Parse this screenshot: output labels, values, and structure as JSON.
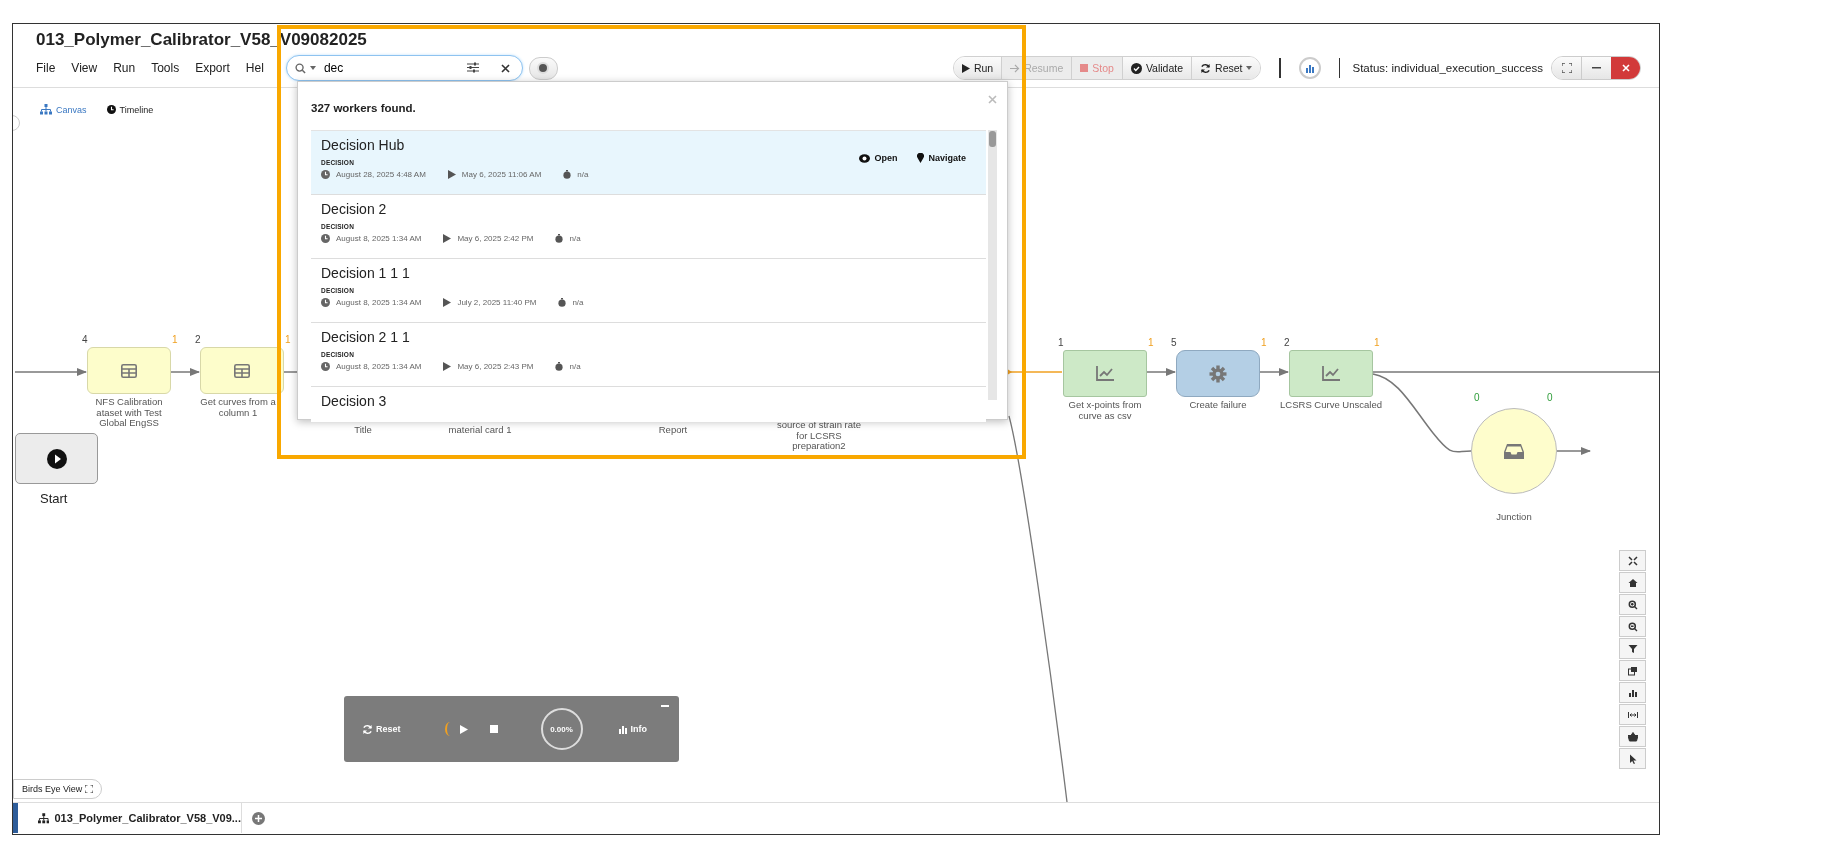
{
  "window": {
    "title": "013_Polymer_Calibrator_V58_V09082025"
  },
  "menu": [
    "File",
    "View",
    "Run",
    "Tools",
    "Export",
    "Hel"
  ],
  "search": {
    "value": "dec"
  },
  "toolbar": {
    "buttons": [
      {
        "label": "Run",
        "kind": "run",
        "disabled": false
      },
      {
        "label": "Resume",
        "kind": "resume",
        "disabled": true
      },
      {
        "label": "Stop",
        "kind": "stop",
        "disabled": true
      },
      {
        "label": "Validate",
        "kind": "validate",
        "disabled": false
      },
      {
        "label": "Reset",
        "kind": "reset",
        "disabled": false
      }
    ],
    "status": "Status: individual_execution_success"
  },
  "view_tabs": [
    {
      "label": "Canvas",
      "kind": "canvas",
      "selected": true
    },
    {
      "label": "Timeline",
      "kind": "timeline",
      "selected": false
    }
  ],
  "search_results": {
    "summary": "327 workers found.",
    "items": [
      {
        "title": "Decision Hub",
        "type": "DECISION",
        "modified": "August 28, 2025 4:48 AM",
        "last_run": "May 6, 2025 11:06 AM",
        "duration": "n/a",
        "selected": true,
        "actions": [
          "Open",
          "Navigate"
        ]
      },
      {
        "title": "Decision 2",
        "type": "DECISION",
        "modified": "August 8, 2025 1:34 AM",
        "last_run": "May 6, 2025 2:42 PM",
        "duration": "n/a",
        "selected": false
      },
      {
        "title": "Decision 1 1 1",
        "type": "DECISION",
        "modified": "August 8, 2025 1:34 AM",
        "last_run": "July 2, 2025 11:40 PM",
        "duration": "n/a",
        "selected": false
      },
      {
        "title": "Decision 2 1 1",
        "type": "DECISION",
        "modified": "August 8, 2025 1:34 AM",
        "last_run": "May 6, 2025 2:43 PM",
        "duration": "n/a",
        "selected": false
      },
      {
        "title": "Decision 3",
        "selected": false
      }
    ]
  },
  "canvas": {
    "start": {
      "label": "Start"
    },
    "nodes": [
      {
        "kind": "table",
        "label": "NFS Calibration\nataset with Test\nGlobal EngSS",
        "inputs": "4",
        "outputs": "1"
      },
      {
        "kind": "table",
        "label": "Get curves from a\ncolumn 1",
        "inputs": "2",
        "outputs": "1"
      },
      {
        "kind": "chart",
        "label": "Get x-points from\ncurve as csv",
        "inputs": "1",
        "outputs": "1"
      },
      {
        "kind": "gear",
        "label": "Create failure",
        "inputs": "5",
        "outputs": "1"
      },
      {
        "kind": "chart",
        "label": "LCSRS Curve Unscaled",
        "inputs": "2",
        "outputs": "1"
      },
      {
        "kind": "junction",
        "label": "Junction",
        "inputs": "0",
        "outputs": "0"
      }
    ],
    "partial_labels": [
      "Title",
      "material card 1",
      "Report",
      "source of strain rate\nfor LCSRS\npreparation2"
    ]
  },
  "player": {
    "reset": "Reset",
    "progress": "0.00%",
    "info": "Info"
  },
  "birds_eye": "Birds Eye View",
  "document_tab": {
    "label": "013_Polymer_Calibrator_V58_V09..."
  }
}
